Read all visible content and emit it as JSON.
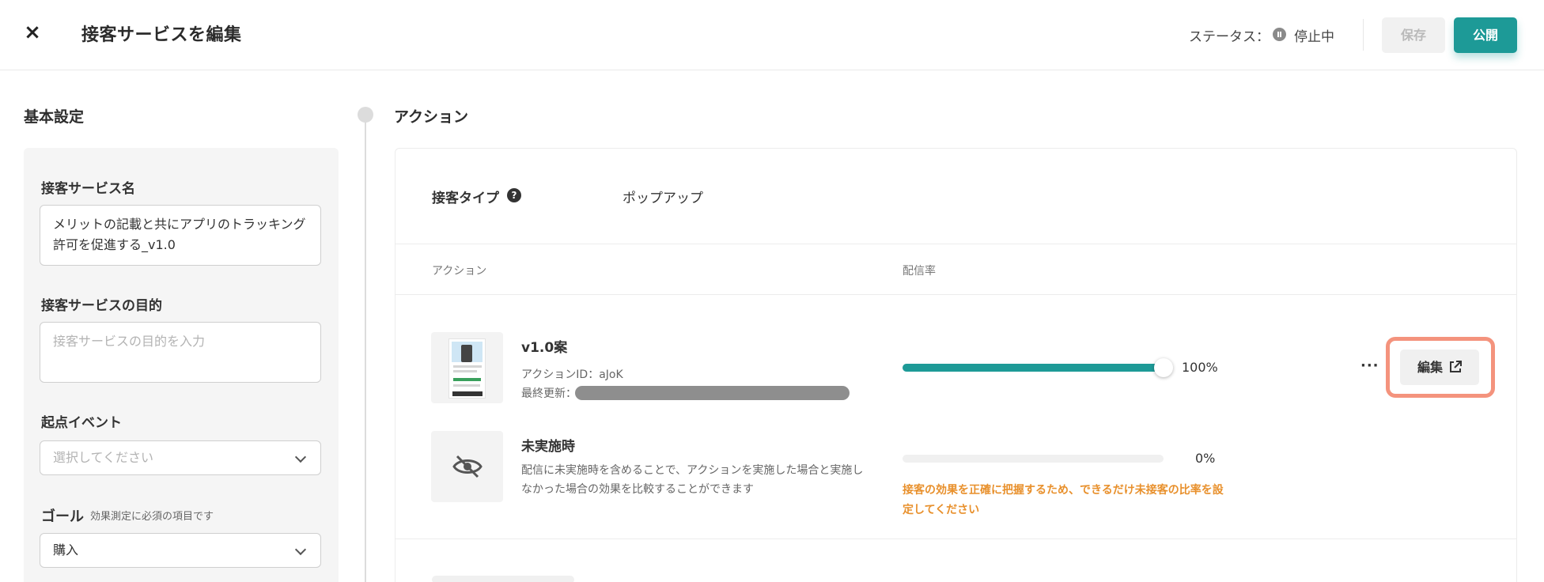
{
  "header": {
    "close_glyph": "×",
    "title": "接客サービスを編集",
    "status_label": "ステータス：",
    "status_value": "停止中",
    "save_label": "保存",
    "publish_label": "公開"
  },
  "basic_settings": {
    "section_title": "基本設定",
    "service_name_label": "接客サービス名",
    "service_name_value": "メリットの記載と共にアプリのトラッキング許可を促進する_v1.0",
    "purpose_label": "接客サービスの目的",
    "purpose_placeholder": "接客サービスの目的を入力",
    "start_event_label": "起点イベント",
    "start_event_placeholder": "選択してください",
    "goal_label": "ゴール",
    "goal_note": "効果測定に必須の項目です",
    "goal_value": "購入"
  },
  "actions": {
    "section_title": "アクション",
    "type_label": "接客タイプ",
    "type_help_icon": "question-circle-icon",
    "type_value": "ポップアップ",
    "columns": [
      "アクション",
      "配信率"
    ],
    "items": [
      {
        "title": "v1.0案",
        "action_id": "アクションID：aJoK",
        "last_updated_label": "最終更新：",
        "rate": 100,
        "rate_label": "100%",
        "more_label": "···",
        "edit_label": "編集",
        "thumbnail_icon": "popup-thumbnail"
      },
      {
        "title": "未実施時",
        "description": "配信に未実施時を含めることで、アクションを実施した場合と実施しなかった場合の効果を比較することができます",
        "rate": 0,
        "rate_label": "0%",
        "warning": "接客の効果を正確に把握するため、できるだけ未接客の比率を設定してください",
        "thumbnail_icon": "eye-slash-icon"
      }
    ]
  },
  "colors": {
    "accent": "#1d9a97",
    "warning": "#e8902c",
    "highlight": "#f4937d"
  }
}
